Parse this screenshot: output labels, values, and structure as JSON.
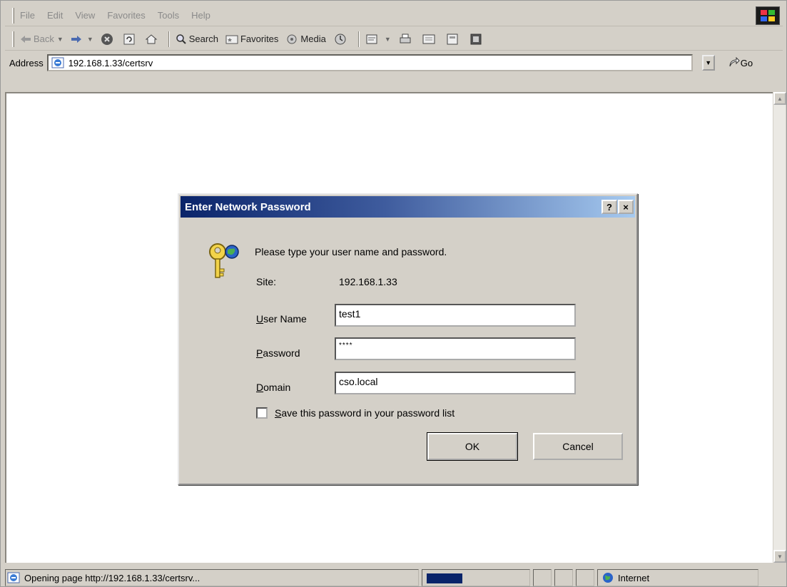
{
  "menu": [
    "File",
    "Edit",
    "View",
    "Favorites",
    "Tools",
    "Help"
  ],
  "toolbar": {
    "back": "Back",
    "search": "Search",
    "favorites": "Favorites",
    "media": "Media"
  },
  "address": {
    "label": "Address",
    "url": "192.168.1.33/certsrv",
    "go": "Go"
  },
  "dialog": {
    "title": "Enter Network Password",
    "help_btn": "?",
    "close_btn": "×",
    "prompt": "Please type your user name and password.",
    "site_label": "Site:",
    "site_value": "192.168.1.33",
    "user_label_accel": "U",
    "user_label_rest": "ser Name",
    "user_value": "test1",
    "password_label_accel": "P",
    "password_label_rest": "assword",
    "password_value": "****",
    "domain_label_accel": "D",
    "domain_label_rest": "omain",
    "domain_value": "cso.local",
    "save_accel": "S",
    "save_rest": "ave this password in your password list",
    "ok": "OK",
    "cancel": "Cancel"
  },
  "status": {
    "text": "Opening page http://192.168.1.33/certsrv...",
    "zone": "Internet"
  },
  "colors": {
    "title_gradient_start": "#0a246a",
    "title_gradient_end": "#a6caf0",
    "progress": "#0a246a"
  }
}
